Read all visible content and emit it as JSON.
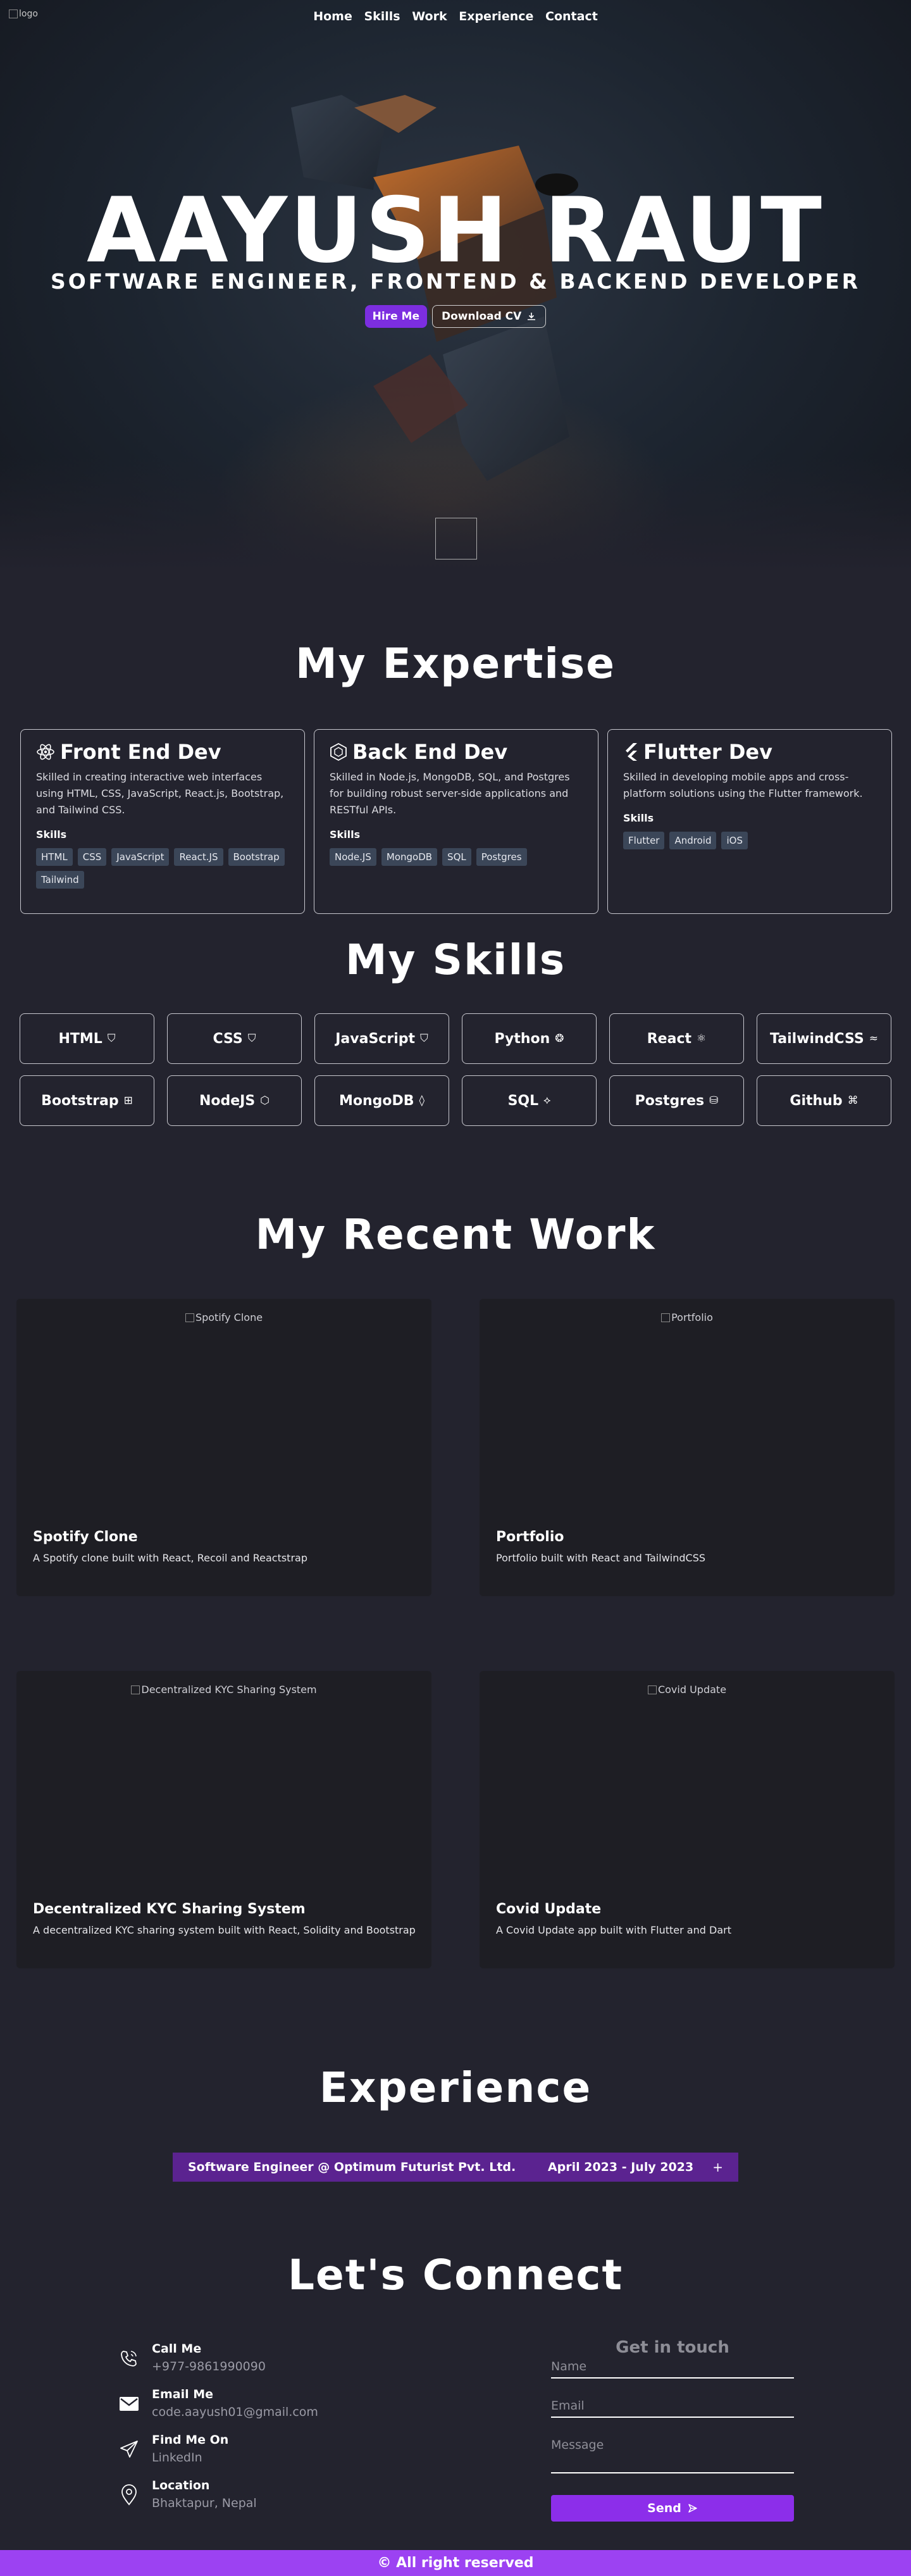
{
  "nav": {
    "logo_alt": "logo",
    "links": [
      "Home",
      "Skills",
      "Work",
      "Experience",
      "Contact"
    ]
  },
  "hero": {
    "name": "AAYUSH RAUT",
    "role": "SOFTWARE ENGINEER, FRONTEND & BACKEND DEVELOPER",
    "hire_label": "Hire Me",
    "cv_label": "Download CV"
  },
  "expertise": {
    "title": "My Expertise",
    "cards": [
      {
        "title": "Front End Dev",
        "icon": "react-icon",
        "desc": "Skilled in creating interactive web interfaces using HTML, CSS, JavaScript, React.js, Bootstrap, and Tailwind CSS.",
        "skills_label": "Skills",
        "tags": [
          "HTML",
          "CSS",
          "JavaScript",
          "React.JS",
          "Bootstrap",
          "Tailwind"
        ]
      },
      {
        "title": "Back End Dev",
        "icon": "nodejs-icon",
        "desc": "Skilled in Node.js, MongoDB, SQL, and Postgres for building robust server-side applications and RESTful APIs.",
        "skills_label": "Skills",
        "tags": [
          "Node.JS",
          "MongoDB",
          "SQL",
          "Postgres"
        ]
      },
      {
        "title": "Flutter Dev",
        "icon": "flutter-icon",
        "desc": "Skilled in developing mobile apps and cross-platform solutions using the Flutter framework.",
        "skills_label": "Skills",
        "tags": [
          "Flutter",
          "Android",
          "iOS"
        ]
      }
    ]
  },
  "skills": {
    "title": "My Skills",
    "items": [
      {
        "label": "HTML",
        "icon": "html5-icon",
        "glyph": "⛉"
      },
      {
        "label": "CSS",
        "icon": "css3-icon",
        "glyph": "⛉"
      },
      {
        "label": "JavaScript",
        "icon": "js-icon",
        "glyph": "⛉"
      },
      {
        "label": "Python",
        "icon": "python-icon",
        "glyph": "❂"
      },
      {
        "label": "React",
        "icon": "react-icon",
        "glyph": "⚛"
      },
      {
        "label": "TailwindCSS",
        "icon": "tailwind-icon",
        "glyph": "≈"
      },
      {
        "label": "Bootstrap",
        "icon": "bootstrap-icon",
        "glyph": "⊞"
      },
      {
        "label": "NodeJS",
        "icon": "nodejs-icon",
        "glyph": "⬡"
      },
      {
        "label": "MongoDB",
        "icon": "mongodb-icon",
        "glyph": "◊"
      },
      {
        "label": "SQL",
        "icon": "sql-icon",
        "glyph": "⟡"
      },
      {
        "label": "Postgres",
        "icon": "postgres-icon",
        "glyph": "⛁"
      },
      {
        "label": "Github",
        "icon": "github-icon",
        "glyph": "⌘"
      }
    ]
  },
  "work": {
    "title": "My Recent Work",
    "items": [
      {
        "img_alt": "Spotify Clone",
        "title": "Spotify Clone",
        "desc": "A Spotify clone built with React, Recoil and Reactstrap"
      },
      {
        "img_alt": "Portfolio",
        "title": "Portfolio",
        "desc": "Portfolio built with React and TailwindCSS"
      },
      {
        "img_alt": "Decentralized KYC Sharing System",
        "title": "Decentralized KYC Sharing System",
        "desc": "A decentralized KYC sharing system built with React, Solidity and Bootstrap"
      },
      {
        "img_alt": "Covid Update",
        "title": "Covid Update",
        "desc": "A Covid Update app built with Flutter and Dart"
      }
    ]
  },
  "experience": {
    "title": "Experience",
    "role": "Software Engineer @ Optimum Futurist Pvt. Ltd.",
    "date": "April 2023 - July 2023",
    "expand": "+"
  },
  "contact": {
    "title": "Let's Connect",
    "items": [
      {
        "label": "Call Me",
        "value": "+977-9861990090",
        "icon": "phone-icon"
      },
      {
        "label": "Email Me",
        "value": "code.aayush01@gmail.com",
        "icon": "mail-icon"
      },
      {
        "label": "Find Me On",
        "value": "LinkedIn",
        "icon": "send-icon"
      },
      {
        "label": "Location",
        "value": "Bhaktapur, Nepal",
        "icon": "location-icon"
      }
    ],
    "form": {
      "title": "Get in touch",
      "name_placeholder": "Name",
      "email_placeholder": "Email",
      "message_placeholder": "Message",
      "send_label": "Send"
    }
  },
  "footer": {
    "text": "© All right reserved"
  },
  "colors": {
    "accent": "#7c2ee0",
    "footer": "#9c42f2",
    "background": "#23232e",
    "experience_bar": "#5b2390"
  }
}
